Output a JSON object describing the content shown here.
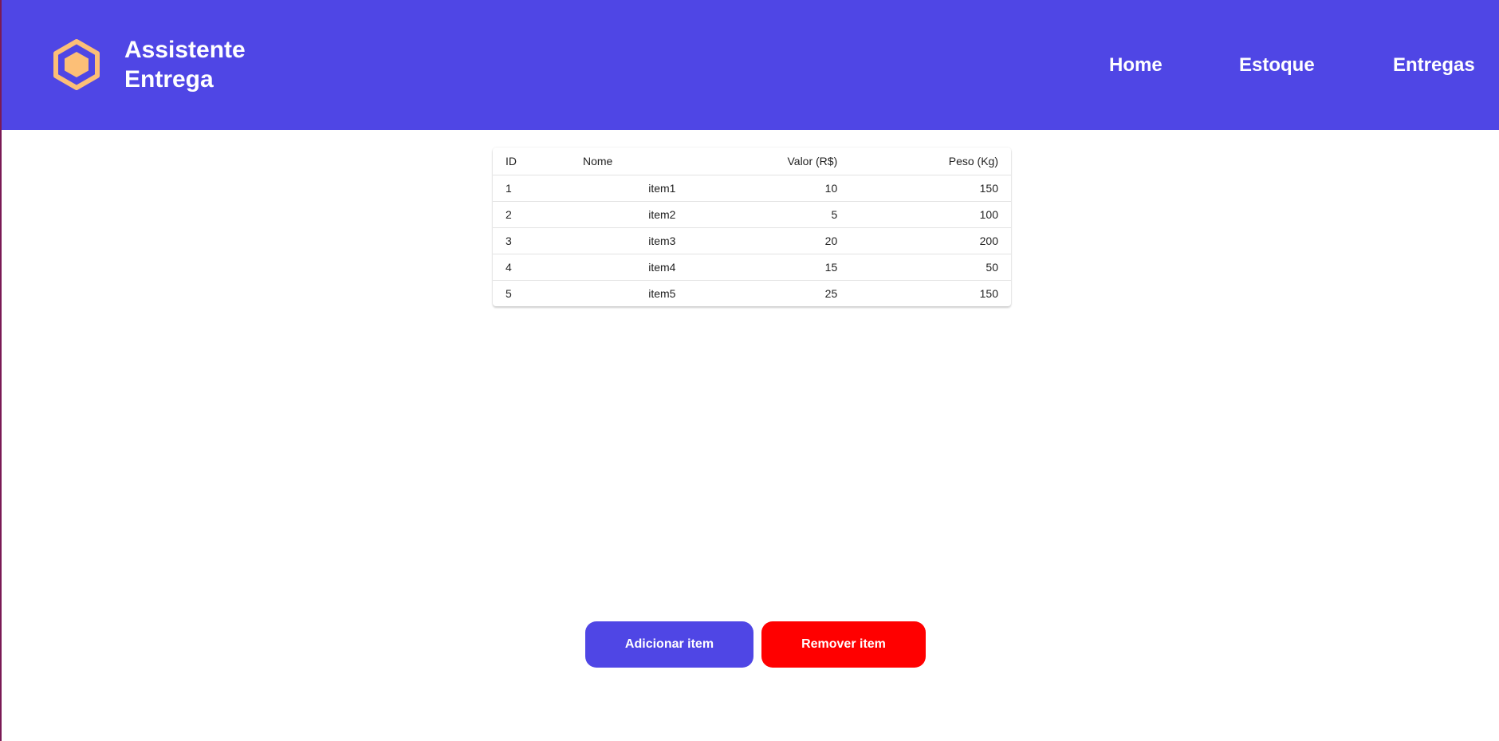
{
  "header": {
    "title": "Assistente Entrega",
    "nav": [
      {
        "label": "Home"
      },
      {
        "label": "Estoque"
      },
      {
        "label": "Entregas"
      }
    ],
    "brand_color": "#4f46e5",
    "logo_color": "#fcbf77",
    "logo_icon": "hexagon-icon"
  },
  "table": {
    "columns": [
      "ID",
      "Nome",
      "Valor (R$)",
      "Peso (Kg)"
    ],
    "rows": [
      [
        "1",
        "item1",
        "10",
        "150"
      ],
      [
        "2",
        "item2",
        "5",
        "100"
      ],
      [
        "3",
        "item3",
        "20",
        "200"
      ],
      [
        "4",
        "item4",
        "15",
        "50"
      ],
      [
        "5",
        "item5",
        "25",
        "150"
      ]
    ]
  },
  "actions": {
    "add_label": "Adicionar item",
    "remove_label": "Remover item",
    "add_color": "#4f46e5",
    "remove_color": "#ff0000"
  }
}
